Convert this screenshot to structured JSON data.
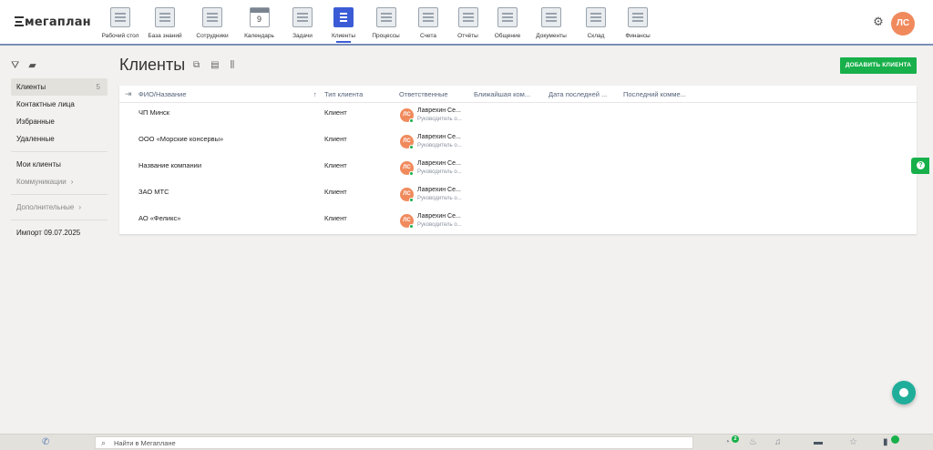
{
  "app": {
    "logo": "мегаплан"
  },
  "nav": [
    {
      "label": "Рабочий стол",
      "icon": "desktop-icon"
    },
    {
      "label": "База знаний",
      "icon": "knowledge-base-icon"
    },
    {
      "label": "Сотрудники",
      "icon": "employees-icon"
    },
    {
      "label": "Календарь",
      "icon": "calendar-icon",
      "day": "9"
    },
    {
      "label": "Задачи",
      "icon": "tasks-icon"
    },
    {
      "label": "Клиенты",
      "icon": "clients-icon",
      "active": true
    },
    {
      "label": "Процессы",
      "icon": "processes-icon"
    },
    {
      "label": "Счета",
      "icon": "invoices-icon"
    },
    {
      "label": "Отчёты",
      "icon": "reports-icon"
    },
    {
      "label": "Общение",
      "icon": "chat-icon"
    },
    {
      "label": "Документы",
      "icon": "documents-icon"
    },
    {
      "label": "Склад",
      "icon": "warehouse-icon"
    },
    {
      "label": "Финансы",
      "icon": "finance-icon"
    }
  ],
  "user": {
    "initials": "ЛС"
  },
  "sidebar": {
    "items": [
      {
        "label": "Клиенты",
        "count": "5"
      },
      {
        "label": "Контактные лица"
      },
      {
        "label": "Избранные"
      },
      {
        "label": "Удаленные"
      },
      {
        "label": "Мои клиенты"
      },
      {
        "label": "Коммуникации"
      },
      {
        "label": "Дополнительные"
      },
      {
        "label": "Импорт 09.07.2025"
      }
    ]
  },
  "page": {
    "title": "Клиенты",
    "add_button": "ДОБАВИТЬ КЛИЕНТА"
  },
  "table": {
    "columns": [
      "ФИО/Название",
      "Тип клиента",
      "Ответственные",
      "Ближайшая ком...",
      "Дата последней ...",
      "Последний комме..."
    ],
    "rows": [
      {
        "name": "ЧП Минск",
        "type": "Клиент",
        "resp_initials": "ЛС",
        "resp_name": "Лаврехин Се...",
        "resp_role": "Руководитель о..."
      },
      {
        "name": "ООО «Морские консервы»",
        "type": "Клиент",
        "resp_initials": "ЛС",
        "resp_name": "Лаврехин Се...",
        "resp_role": "Руководитель о..."
      },
      {
        "name": "Название компании",
        "type": "Клиент",
        "resp_initials": "ЛС",
        "resp_name": "Лаврехин Се...",
        "resp_role": "Руководитель о..."
      },
      {
        "name": "ЗАО МТС",
        "type": "Клиент",
        "resp_initials": "ЛС",
        "resp_name": "Лаврехин Се...",
        "resp_role": "Руководитель о..."
      },
      {
        "name": "АО «Феликс»",
        "type": "Клиент",
        "resp_initials": "ЛС",
        "resp_name": "Лаврехин Се...",
        "resp_role": "Руководитель о..."
      }
    ]
  },
  "bottombar": {
    "search_placeholder": "Найти в Мегаплане",
    "notif_count": "2"
  },
  "colors": {
    "accent": "#3b5bd6",
    "green": "#18b04a",
    "avatar": "#f08a5d"
  }
}
